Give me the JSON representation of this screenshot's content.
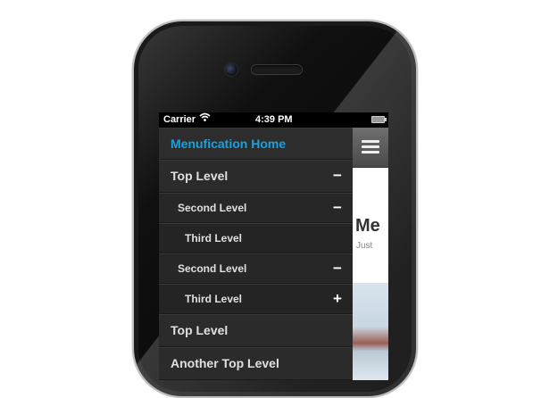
{
  "status_bar": {
    "carrier": "Carrier",
    "wifi_icon": "wifi-icon",
    "time": "4:39 PM",
    "battery_icon": "battery-icon"
  },
  "menu": {
    "home_label": "Menufication Home",
    "home_color": "#1aa1e1",
    "items": [
      {
        "level": 1,
        "label": "Top Level",
        "toggle": "−"
      },
      {
        "level": 2,
        "label": "Second Level",
        "toggle": "−"
      },
      {
        "level": 3,
        "label": "Third Level",
        "toggle": ""
      },
      {
        "level": 2,
        "label": "Second Level",
        "toggle": "−"
      },
      {
        "level": 3,
        "label": "Third Level",
        "toggle": "+"
      },
      {
        "level": 1,
        "label": "Top Level",
        "toggle": ""
      },
      {
        "level": 1,
        "label": "Another Top Level",
        "toggle": ""
      }
    ]
  },
  "content": {
    "menu_icon": "hamburger-icon",
    "title_fragment": "Me",
    "subtitle_fragment": "Just"
  }
}
